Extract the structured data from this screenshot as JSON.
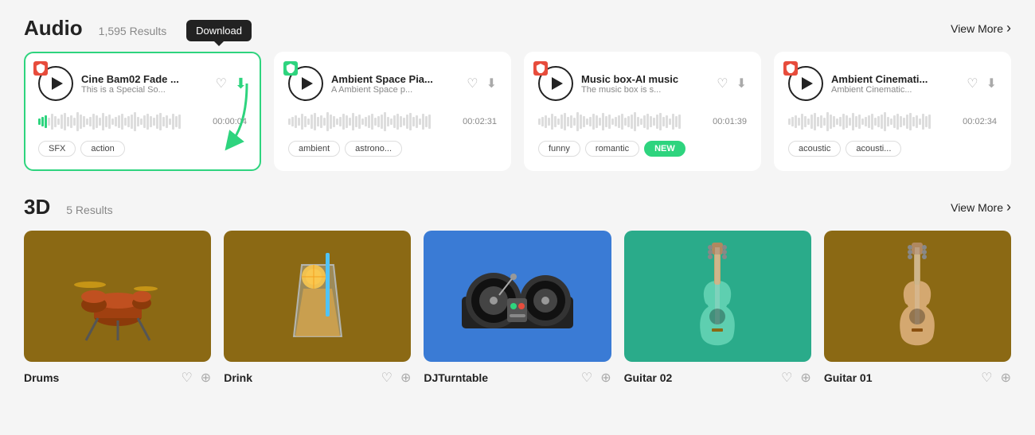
{
  "audio_section": {
    "title": "Audio",
    "count": "1,595 Results",
    "view_more": "View More",
    "cards": [
      {
        "id": "card1",
        "highlighted": true,
        "title": "Cine Bam02 Fade ...",
        "subtitle": "This is a Special So...",
        "duration": "00:00:04",
        "tags": [
          "SFX",
          "action"
        ],
        "waveform_active": 2
      },
      {
        "id": "card2",
        "highlighted": false,
        "title": "Ambient Space Pia...",
        "subtitle": "A Ambient Space p...",
        "duration": "00:02:31",
        "tags": [
          "ambient",
          "astrono..."
        ],
        "waveform_active": 0
      },
      {
        "id": "card3",
        "highlighted": false,
        "title": "Music box-AI music",
        "subtitle": "The music box is s...",
        "duration": "00:01:39",
        "tags": [
          "funny",
          "romantic",
          "NEW"
        ],
        "waveform_active": 0
      },
      {
        "id": "card4",
        "highlighted": false,
        "title": "Ambient Cinemati...",
        "subtitle": "Ambient Cinematic...",
        "duration": "00:02:34",
        "tags": [
          "acoustic",
          "acousti..."
        ],
        "waveform_active": 0
      }
    ],
    "download_tooltip": "Download"
  },
  "three_d_section": {
    "title": "3D",
    "count": "5 Results",
    "view_more": "View More",
    "cards": [
      {
        "name": "Drums",
        "bg_color": "#8B6914",
        "icon": "drums"
      },
      {
        "name": "Drink",
        "bg_color": "#8B6914",
        "icon": "drink"
      },
      {
        "name": "DJTurntable",
        "bg_color": "#3a7bd5",
        "icon": "turntable"
      },
      {
        "name": "Guitar 02",
        "bg_color": "#2aab8a",
        "icon": "guitar2"
      },
      {
        "name": "Guitar 01",
        "bg_color": "#8B6914",
        "icon": "guitar1"
      }
    ]
  },
  "icons": {
    "heart": "♡",
    "download": "⬇",
    "cart": "🛒",
    "heart_outline": "♡"
  }
}
